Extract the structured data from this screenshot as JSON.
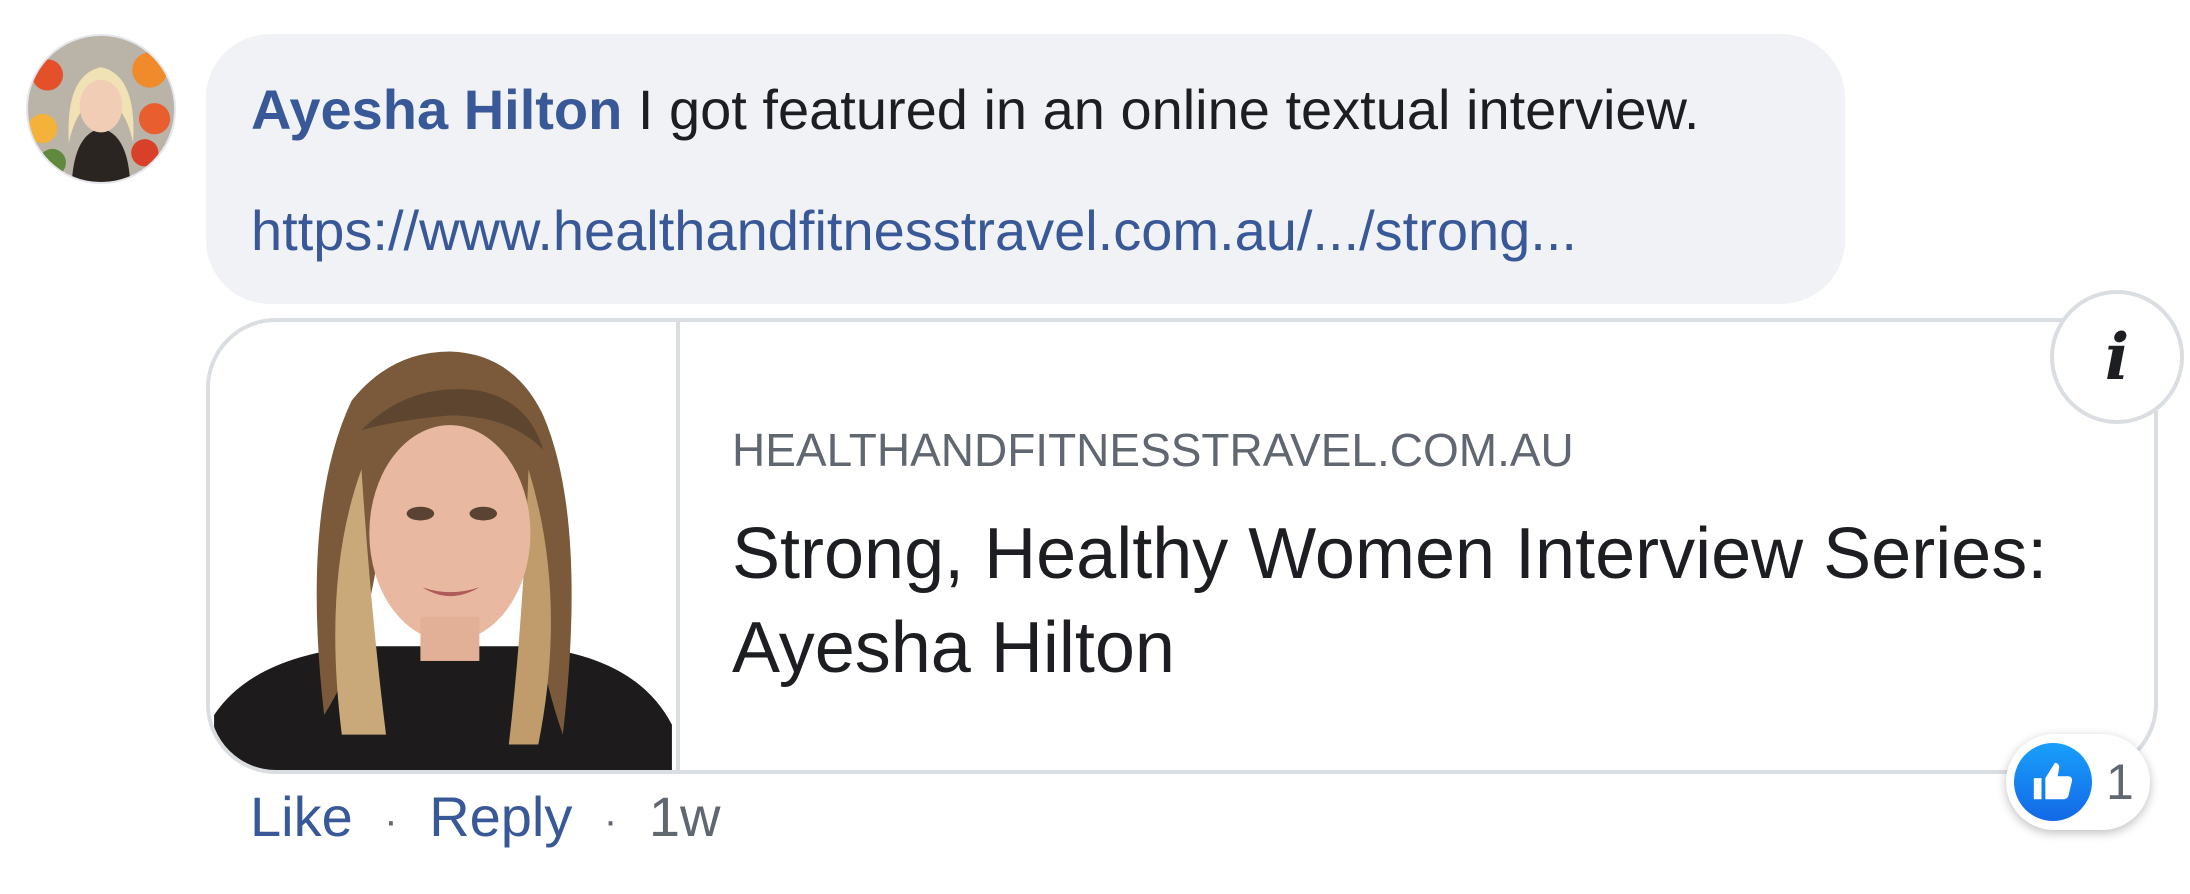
{
  "comment": {
    "author": "Ayesha Hilton",
    "text": "I got featured in an online textual interview.",
    "link": "https://www.healthandfitnesstravel.com.au/.../strong..."
  },
  "link_preview": {
    "domain": "HEALTHANDFITNESSTRAVEL.COM.AU",
    "title": "Strong, Healthy Women Interview Series: Ayesha Hilton",
    "info_icon": "i"
  },
  "actions": {
    "like": "Like",
    "separator": "·",
    "reply": "Reply",
    "time": "1w"
  },
  "reaction": {
    "icon": "thumbs-up-icon",
    "count": "1",
    "color": "#1877f2"
  },
  "colors": {
    "link": "#385898",
    "bubble": "#f0f2f5",
    "text": "#1c1e21",
    "secondary": "#606770"
  }
}
